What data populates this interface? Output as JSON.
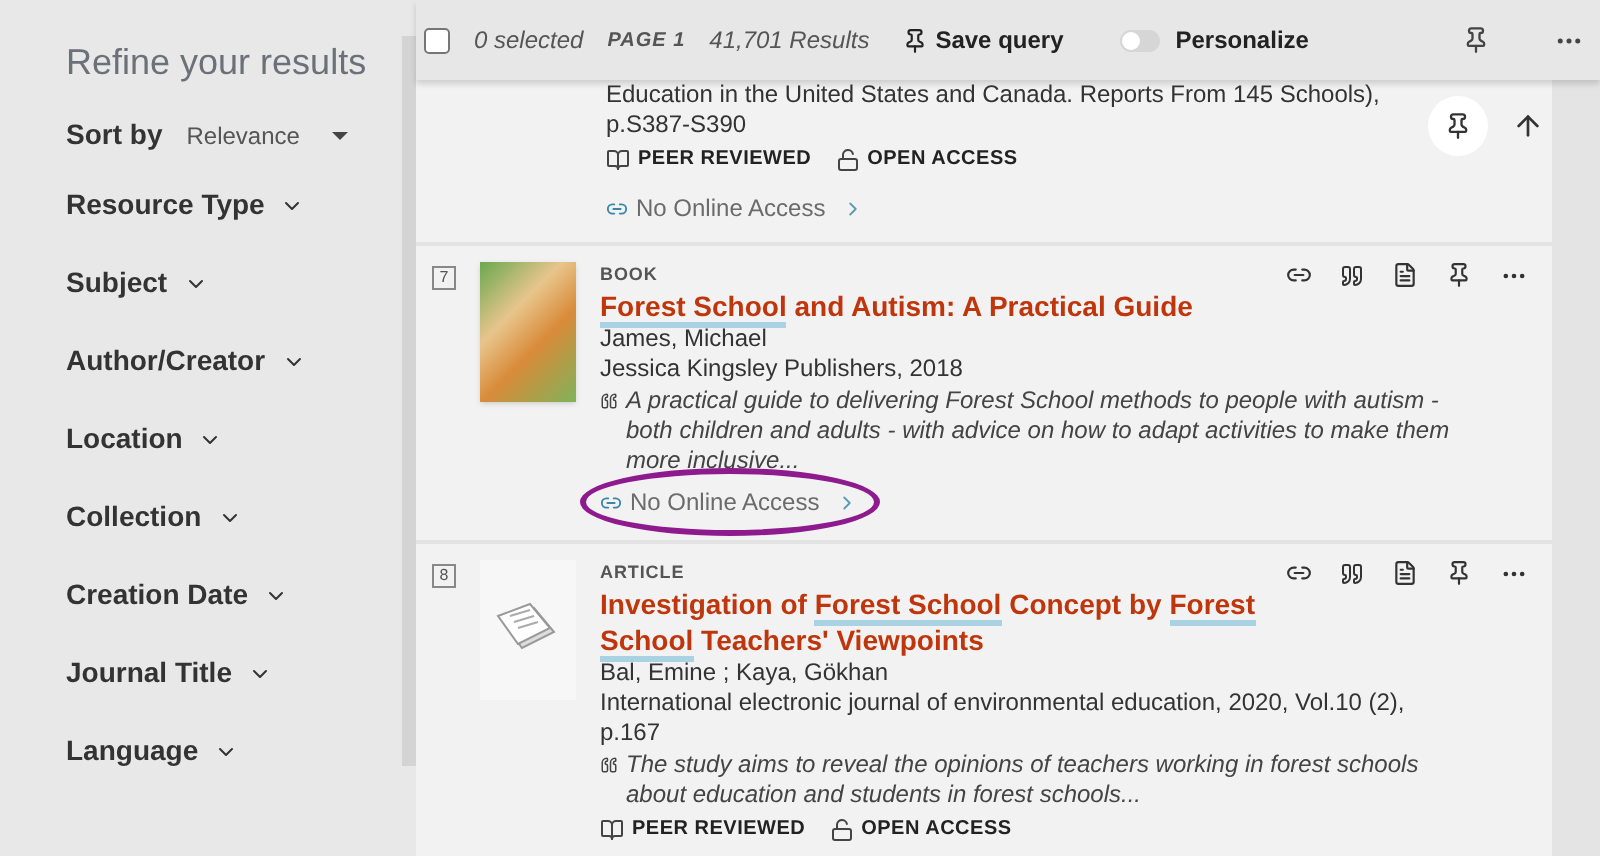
{
  "sidebar": {
    "title": "Refine your results",
    "sort": {
      "label": "Sort by",
      "value": "Relevance"
    },
    "facets": [
      {
        "label": "Resource Type"
      },
      {
        "label": "Subject"
      },
      {
        "label": "Author/Creator"
      },
      {
        "label": "Location"
      },
      {
        "label": "Collection"
      },
      {
        "label": "Creation Date"
      },
      {
        "label": "Journal Title"
      },
      {
        "label": "Language"
      }
    ]
  },
  "toolbar": {
    "checked": false,
    "selected": "0 selected",
    "page": "PAGE 1",
    "results": "41,701 Results",
    "save_query": "Save query",
    "personalize": {
      "label": "Personalize",
      "on": false
    }
  },
  "previous_result": {
    "lines": [
      "Education in the United States and Canada. Reports From 145 Schools),",
      "p.S387-S390"
    ],
    "badges": [
      "PEER REVIEWED",
      "OPEN ACCESS"
    ],
    "link": {
      "label": "No Online Access",
      "circled": false
    }
  },
  "results": [
    {
      "number": "7",
      "kind": "book",
      "type": "BOOK",
      "title": [
        {
          "text": "Forest School",
          "highlight": true
        },
        {
          "text": " and Autism: A Practical Guide",
          "highlight": false
        }
      ],
      "lines": [
        "James, Michael",
        "Jessica Kingsley Publishers, 2018"
      ],
      "abstract": "A practical guide to delivering Forest School methods to people with autism - both children and adults - with advice on how to adapt activities to make them more inclusive...",
      "link": {
        "label": "No Online Access",
        "circled": true
      }
    },
    {
      "number": "8",
      "kind": "article",
      "type": "ARTICLE",
      "title": [
        {
          "text": "Investigation of ",
          "highlight": false
        },
        {
          "text": "Forest School",
          "highlight": true
        },
        {
          "text": " Concept by ",
          "highlight": false
        },
        {
          "text": "Forest ",
          "highlight": true
        },
        {
          "text": "School",
          "highlight": true
        },
        {
          "text": " Teachers' Viewpoints",
          "highlight": false
        }
      ],
      "lines": [
        "Bal, Emine ; Kaya, Gökhan",
        "International electronic journal of environmental education, 2020, Vol.10 (2), p.167"
      ],
      "abstract": "The study aims to reveal the opinions of teachers working in forest schools about education and students in forest schools...",
      "badges": [
        "PEER REVIEWED",
        "OPEN ACCESS"
      ]
    }
  ]
}
